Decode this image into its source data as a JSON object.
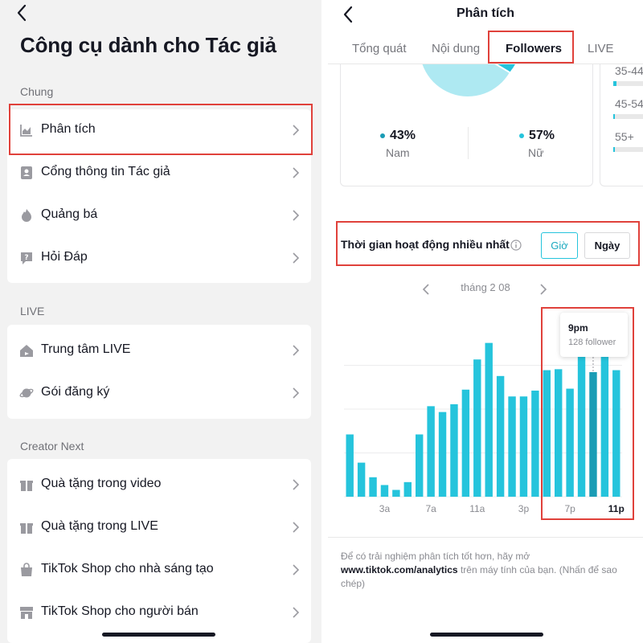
{
  "left_panel": {
    "title": "Công cụ dành cho Tác giả",
    "sections": [
      {
        "label": "Chung",
        "items": [
          {
            "label": "Phân tích",
            "icon": "chart-icon"
          },
          {
            "label": "Cổng thông tin Tác giả",
            "icon": "book-icon"
          },
          {
            "label": "Quảng bá",
            "icon": "flame-icon"
          },
          {
            "label": "Hỏi Đáp",
            "icon": "question-icon"
          }
        ]
      },
      {
        "label": "LIVE",
        "items": [
          {
            "label": "Trung tâm LIVE",
            "icon": "house-icon"
          },
          {
            "label": "Gói đăng ký",
            "icon": "planet-icon"
          }
        ]
      },
      {
        "label": "Creator Next",
        "items": [
          {
            "label": "Quà tặng trong video",
            "icon": "gift-icon"
          },
          {
            "label": "Quà tặng trong LIVE",
            "icon": "gift-icon"
          },
          {
            "label": "TikTok Shop cho nhà sáng tạo",
            "icon": "bag-icon"
          },
          {
            "label": "TikTok Shop cho người bán",
            "icon": "store-icon"
          }
        ]
      }
    ]
  },
  "right_panel": {
    "title": "Phân tích",
    "tabs": [
      "Tổng quát",
      "Nội dung",
      "Followers",
      "LIVE"
    ],
    "active_tab": "Followers",
    "gender": {
      "male": {
        "percent": "43%",
        "label": "Nam"
      },
      "female": {
        "percent": "57%",
        "label": "Nữ"
      }
    },
    "age_groups": [
      {
        "label": "35-44",
        "fraction": 0.1
      },
      {
        "label": "45-54",
        "fraction": 0.05
      },
      {
        "label": "55+",
        "fraction": 0.05
      }
    ],
    "active_section": {
      "title": "Thời gian hoạt động nhiều nhất",
      "hour_button": "Giờ",
      "day_button": "Ngày"
    },
    "date_label": "tháng 2 08",
    "tooltip": {
      "title": "9pm",
      "value": "128 follower"
    },
    "footnote": {
      "before": "Để có trải nghiệm phân tích tốt hơn, hãy mở",
      "link": "www.tiktok.com/analytics",
      "after": "trên máy tính của bạn. (Nhấn để sao chép)"
    }
  },
  "colors": {
    "accent": "#25c4dc",
    "accent_dark": "#1a9cb5",
    "highlight_box": "#e0413b"
  },
  "chart_data": {
    "type": "bar",
    "categories": [
      "12a",
      "1a",
      "2a",
      "3a",
      "4a",
      "5a",
      "6a",
      "7a",
      "8a",
      "9a",
      "10a",
      "11a",
      "12p",
      "1p",
      "2p",
      "3p",
      "4p",
      "5p",
      "6p",
      "7p",
      "8p",
      "9p",
      "10p",
      "11p"
    ],
    "tick_labels": [
      "3a",
      "7a",
      "11a",
      "3p",
      "7p",
      "11p"
    ],
    "values": [
      64,
      35,
      20,
      12,
      7,
      15,
      64,
      93,
      87,
      95,
      110,
      141,
      158,
      124,
      103,
      103,
      109,
      130,
      131,
      111,
      147,
      128,
      155,
      130
    ],
    "highlighted_index": 21,
    "ylim": [
      0,
      180
    ],
    "grid": true
  }
}
